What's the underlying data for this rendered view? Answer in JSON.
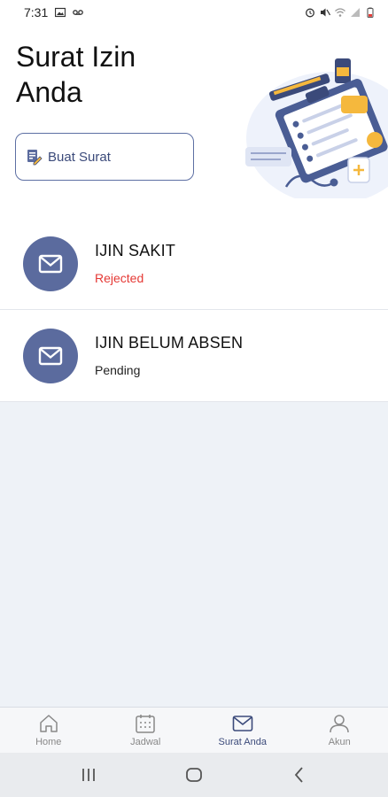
{
  "status_bar": {
    "time": "7:31",
    "icons_left": [
      "image-icon",
      "voicemail-icon"
    ],
    "icons_right": [
      "alarm-icon",
      "mute-icon",
      "wifi-icon",
      "signal-icon",
      "battery-icon"
    ]
  },
  "header": {
    "title": "Surat Izin Anda",
    "create_button_label": "Buat Surat"
  },
  "letters": [
    {
      "type": "IJIN SAKIT",
      "status": "Rejected",
      "status_color": "#e53935"
    },
    {
      "type": "IJIN BELUM ABSEN",
      "status": "Pending",
      "status_color": "#222222"
    }
  ],
  "bottom_nav": {
    "items": [
      {
        "label": "Home",
        "icon": "home-icon"
      },
      {
        "label": "Jadwal",
        "icon": "calendar-icon"
      },
      {
        "label": "Surat Anda",
        "icon": "mail-icon",
        "active": true
      },
      {
        "label": "Akun",
        "icon": "user-icon"
      }
    ]
  },
  "colors": {
    "accent": "#5b6b9e",
    "nav_active": "#3b4a7a",
    "empty_bg": "#eef2f7"
  }
}
